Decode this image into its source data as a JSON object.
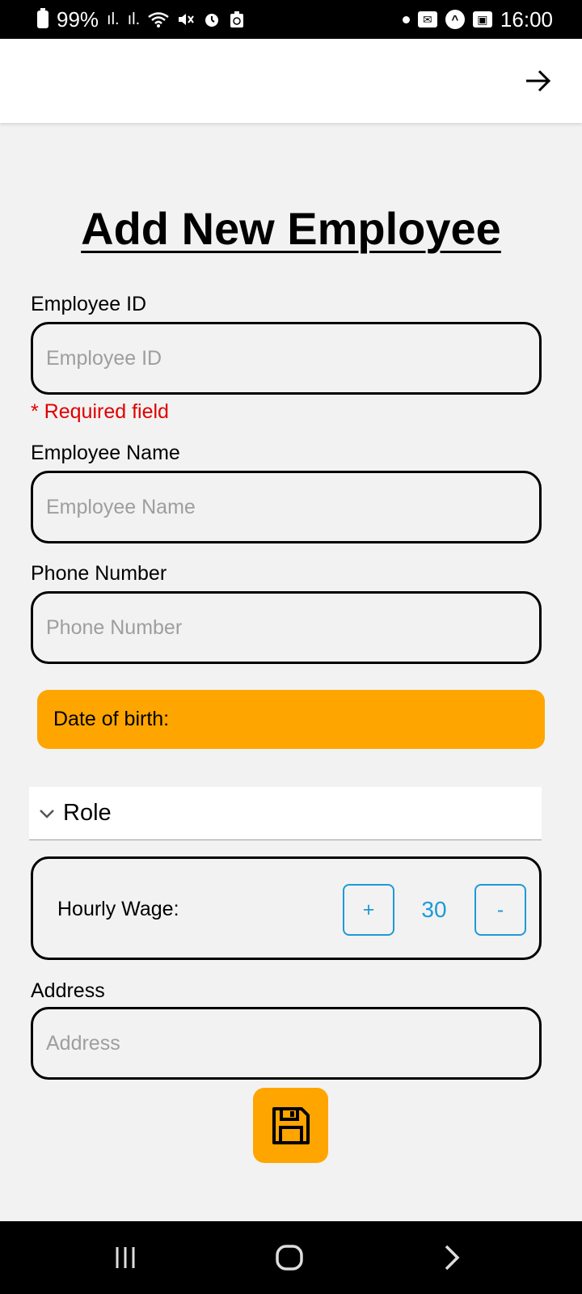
{
  "status_bar": {
    "battery": "99%",
    "time": "16:00"
  },
  "page": {
    "title": "Add New Employee"
  },
  "form": {
    "employee_id": {
      "label": "Employee ID",
      "placeholder": "Employee ID",
      "value": "",
      "error": "* Required field"
    },
    "employee_name": {
      "label": "Employee Name",
      "placeholder": "Employee Name",
      "value": ""
    },
    "phone_number": {
      "label": "Phone Number",
      "placeholder": "Phone Number",
      "value": ""
    },
    "date_of_birth": {
      "label": "Date of birth:"
    },
    "role": {
      "label": "Role"
    },
    "hourly_wage": {
      "label": "Hourly Wage:",
      "value": "30",
      "increment_label": "+",
      "decrement_label": "-"
    },
    "address": {
      "label": "Address",
      "placeholder": "Address",
      "value": ""
    }
  },
  "colors": {
    "accent_orange": "#ffa500",
    "stepper_blue": "#1e9ad6",
    "error_red": "#e00000",
    "background": "#f2f2f2"
  },
  "icons": {
    "app_bar": "arrow-right-icon",
    "save": "floppy-disk-icon",
    "role": "chevron-down-icon",
    "nav": [
      "recents-icon",
      "home-icon",
      "back-icon"
    ]
  }
}
